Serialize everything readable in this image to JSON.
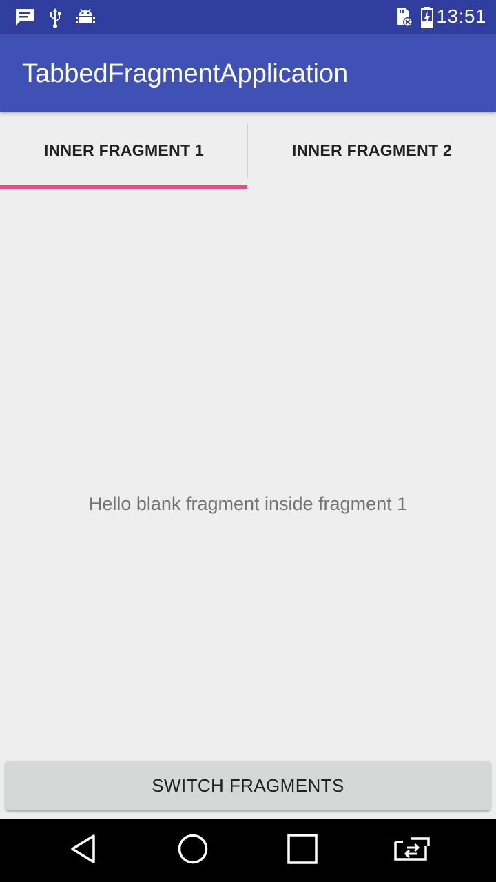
{
  "status_bar": {
    "time": "13:51",
    "icons": [
      "message-icon",
      "usb-icon",
      "android-debug-icon",
      "sd-card-icon",
      "battery-charging-icon"
    ]
  },
  "app_bar": {
    "title": "TabbedFragmentApplication",
    "color": "#3f51b5"
  },
  "tabs": [
    {
      "label": "INNER FRAGMENT 1",
      "selected": true
    },
    {
      "label": "INNER FRAGMENT 2",
      "selected": false
    }
  ],
  "indicator_color": "#ff4081",
  "content": {
    "message": "Hello blank fragment inside fragment 1"
  },
  "actions": {
    "switch_label": "SWITCH FRAGMENTS"
  },
  "nav_bar": {
    "buttons": [
      "back-icon",
      "home-icon",
      "recents-icon",
      "switch-apps-icon"
    ]
  }
}
